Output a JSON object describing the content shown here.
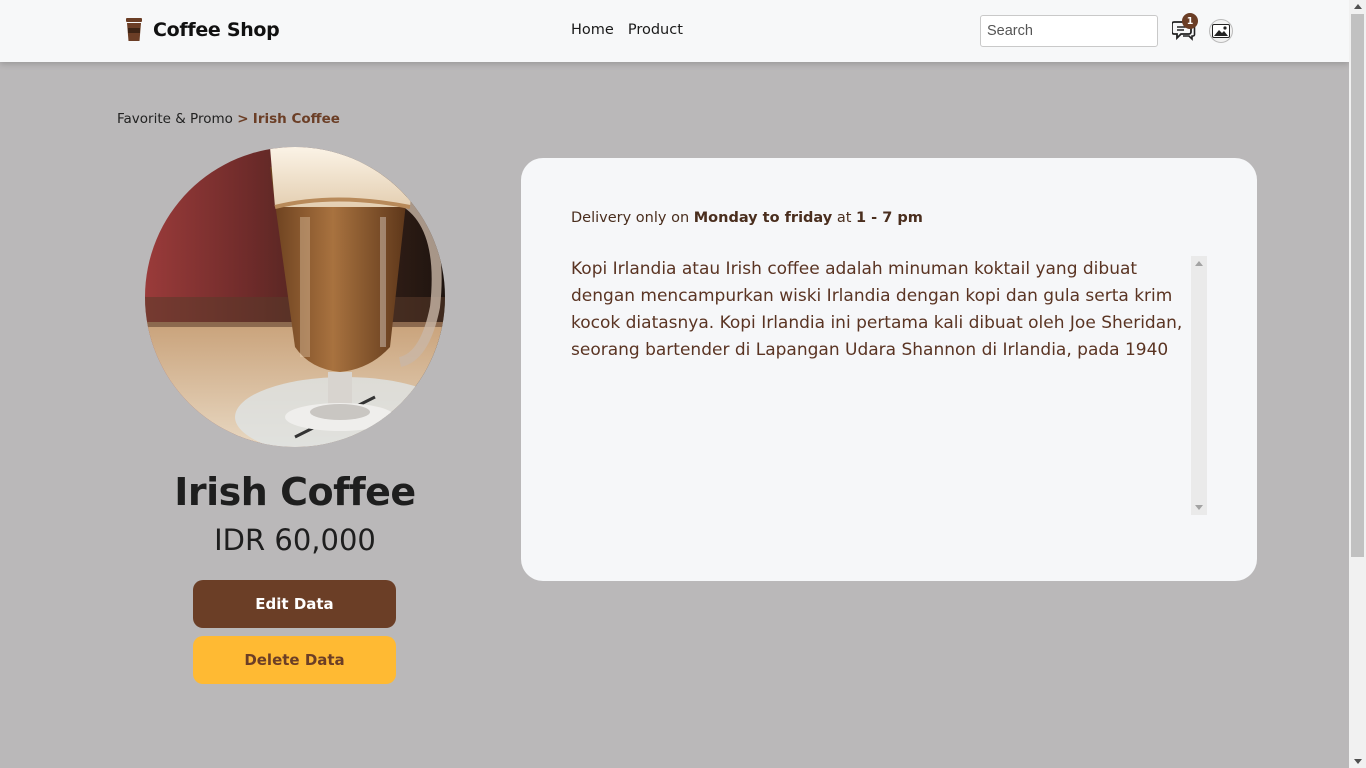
{
  "navbar": {
    "brand_name": "Coffee Shop",
    "links": [
      {
        "label": "Home"
      },
      {
        "label": "Product"
      }
    ],
    "search_placeholder": "Search",
    "chat_badge_count": "1"
  },
  "breadcrumb": {
    "parent": "Favorite & Promo",
    "separator": ">",
    "current": "Irish Coffee"
  },
  "product": {
    "name": "Irish Coffee",
    "price": "IDR 60,000",
    "edit_label": "Edit Data",
    "delete_label": "Delete Data"
  },
  "info": {
    "delivery_prefix": "Delivery only on",
    "delivery_days": "Monday to friday",
    "delivery_mid": "at",
    "delivery_time": "1 - 7 pm",
    "description": "Kopi Irlandia atau Irish coffee adalah minuman koktail yang dibuat dengan mencampurkan wiski Irlandia dengan kopi dan gula serta krim kocok diatasnya. Kopi Irlandia ini pertama kali dibuat oleh Joe Sheridan, seorang bartender di Lapangan Udara Shannon di Irlandia, pada 1940"
  },
  "colors": {
    "brand_brown": "#6b3e26",
    "accent_yellow": "#ffba33",
    "page_background": "#bab8b9",
    "card_background": "#f6f7f9"
  },
  "icons": {
    "brand": "coffee-cup-icon",
    "chat": "chat-icon",
    "avatar": "image-placeholder-icon"
  }
}
